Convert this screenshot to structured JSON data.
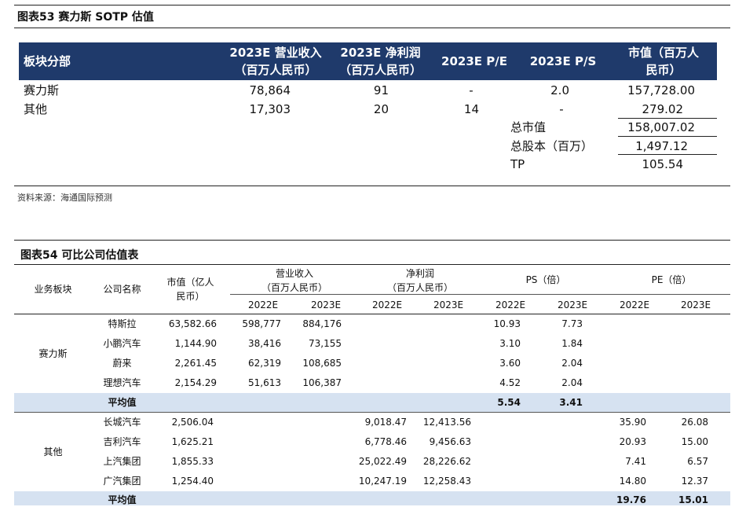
{
  "fig53": {
    "title": "图表53 赛力斯 SOTP 估值",
    "headers": [
      "板块分部",
      "2023E 营业收入",
      "（百万人民币）",
      "2023E 净利润",
      "（百万人民币）",
      "2023E P/E",
      "2023E P/S",
      "市值（百万人",
      "民币）"
    ],
    "rows": [
      {
        "segment": "赛力斯",
        "revenue": "78,864",
        "profit": "91",
        "pe": "-",
        "ps": "2.0",
        "mcap": "157,728.00"
      },
      {
        "segment": "其他",
        "revenue": "17,303",
        "profit": "20",
        "pe": "14",
        "ps": "-",
        "mcap": "279.02"
      }
    ],
    "summary": [
      {
        "label": "总市值",
        "value": "158,007.02"
      },
      {
        "label": "总股本（百万）",
        "value": "1,497.12"
      },
      {
        "label": "TP",
        "value": "105.54"
      }
    ],
    "source": "资料来源：海通国际预测"
  },
  "fig54": {
    "title": "图表54 可比公司估值表",
    "headers": {
      "segment": "业务板块",
      "company": "公司名称",
      "mcap1": "市值（亿人",
      "mcap2": "民币）",
      "rev1": "营业收入",
      "rev2": "（百万人民币）",
      "np1": "净利润",
      "np2": "（百万人民币）",
      "ps": "PS（倍）",
      "pe": "PE（倍）",
      "years": [
        "2022E",
        "2023E",
        "2022E",
        "2023E",
        "2022E",
        "2023E",
        "2022E",
        "2023E"
      ]
    },
    "groups": [
      {
        "segment": "赛力斯",
        "rows": [
          {
            "company": "特斯拉",
            "mcap": "63,582.66",
            "rev22": "598,777",
            "rev23": "884,176",
            "np22": "",
            "np23": "",
            "ps22": "10.93",
            "ps23": "7.73",
            "pe22": "",
            "pe23": ""
          },
          {
            "company": "小鹏汽车",
            "mcap": "1,144.90",
            "rev22": "38,416",
            "rev23": "73,155",
            "np22": "",
            "np23": "",
            "ps22": "3.10",
            "ps23": "1.84",
            "pe22": "",
            "pe23": ""
          },
          {
            "company": "蔚来",
            "mcap": "2,261.45",
            "rev22": "62,319",
            "rev23": "108,685",
            "np22": "",
            "np23": "",
            "ps22": "3.60",
            "ps23": "2.04",
            "pe22": "",
            "pe23": ""
          },
          {
            "company": "理想汽车",
            "mcap": "2,154.29",
            "rev22": "51,613",
            "rev23": "106,387",
            "np22": "",
            "np23": "",
            "ps22": "4.52",
            "ps23": "2.04",
            "pe22": "",
            "pe23": ""
          }
        ],
        "avg": {
          "label": "平均值",
          "ps22": "5.54",
          "ps23": "3.41",
          "pe22": "",
          "pe23": ""
        }
      },
      {
        "segment": "其他",
        "rows": [
          {
            "company": "长城汽车",
            "mcap": "2,506.04",
            "rev22": "",
            "rev23": "",
            "np22": "9,018.47",
            "np23": "12,413.56",
            "ps22": "",
            "ps23": "",
            "pe22": "35.90",
            "pe23": "26.08"
          },
          {
            "company": "吉利汽车",
            "mcap": "1,625.21",
            "rev22": "",
            "rev23": "",
            "np22": "6,778.46",
            "np23": "9,456.63",
            "ps22": "",
            "ps23": "",
            "pe22": "20.93",
            "pe23": "15.00"
          },
          {
            "company": "上汽集团",
            "mcap": "1,855.33",
            "rev22": "",
            "rev23": "",
            "np22": "25,022.49",
            "np23": "28,226.62",
            "ps22": "",
            "ps23": "",
            "pe22": "7.41",
            "pe23": "6.57"
          },
          {
            "company": "广汽集团",
            "mcap": "1,254.40",
            "rev22": "",
            "rev23": "",
            "np22": "10,247.19",
            "np23": "12,258.43",
            "ps22": "",
            "ps23": "",
            "pe22": "14.80",
            "pe23": "12.37"
          }
        ],
        "avg": {
          "label": "平均值",
          "ps22": "",
          "ps23": "",
          "pe22": "19.76",
          "pe23": "15.01"
        }
      }
    ]
  }
}
